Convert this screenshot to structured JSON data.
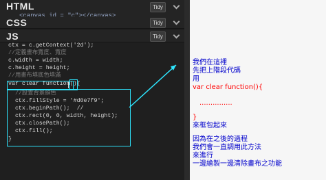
{
  "panels": {
    "html": {
      "title": "HTML",
      "tidy": "Tidy",
      "code": "<canvas id = \"c\"></canvas>"
    },
    "css": {
      "title": "CSS",
      "tidy": "Tidy"
    },
    "js": {
      "title": "JS",
      "tidy": "Tidy"
    }
  },
  "js_lines": [
    {
      "text": "ctx = c.getContext('2d');",
      "cls": "code-line"
    },
    {
      "text": "//定義畫布寬度、寬度",
      "cls": "comment"
    },
    {
      "text": "c.width = width;",
      "cls": "code-line"
    },
    {
      "text": "c.height = height;",
      "cls": "code-line"
    },
    {
      "text": "//用畫布填底色填滿",
      "cls": "comment"
    },
    {
      "text": "var clear function(){",
      "cls": "code-line"
    },
    {
      "text": "  //設置背景顏色",
      "cls": "comment"
    },
    {
      "text": "  ctx.fillStyle = '#d0e7f9';",
      "cls": "code-line"
    },
    {
      "text": "  ctx.beginPath();  //",
      "cls": "code-line"
    },
    {
      "text": "  ctx.rect(0, 0, width, height);",
      "cls": "code-line"
    },
    {
      "text": "  ctx.closePath();",
      "cls": "code-line"
    },
    {
      "text": "  ctx.fill();",
      "cls": "code-line"
    },
    {
      "text": "}",
      "cls": "code-line"
    }
  ],
  "annotation": {
    "l1": "我們在這裡",
    "l2": "先把上階段代碼",
    "l3": "用",
    "l4": "var  clear function(){",
    "l5": "...............",
    "l6": "}",
    "l7": "來框包起來",
    "l8": "因為在之後的過程",
    "l9": "我們會一直調用此方法",
    "l10": "來進行",
    "l11": "一邊繪製一邊清除畫布之功能"
  }
}
